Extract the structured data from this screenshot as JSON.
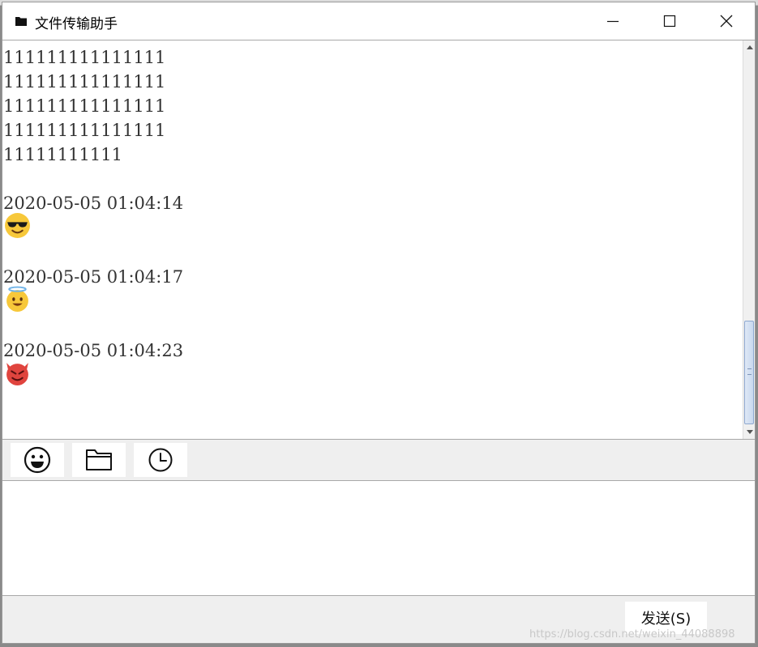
{
  "window": {
    "title": "文件传输助手",
    "icon": "folder-icon",
    "controls": [
      "minimize-icon",
      "maximize-icon",
      "close-icon"
    ]
  },
  "chat": {
    "lines": [
      "111111111111111",
      "111111111111111",
      "111111111111111",
      "111111111111111",
      "11111111111"
    ],
    "messages": [
      {
        "timestamp": "2020-05-05 01:04:14",
        "emoji": "sunglasses-face-emoji"
      },
      {
        "timestamp": "2020-05-05 01:04:17",
        "emoji": "halo-face-emoji"
      },
      {
        "timestamp": "2020-05-05 01:04:23",
        "emoji": "devil-face-emoji"
      }
    ]
  },
  "toolbar": {
    "buttons": [
      "smiley-icon",
      "folder-icon",
      "clock-icon"
    ]
  },
  "input": {
    "value": ""
  },
  "footer": {
    "send_label": "发送(S)",
    "watermark": "https://blog.csdn.net/weixin_44088898"
  },
  "colors": {
    "window_bg": "#efefef",
    "scroll_thumb": "#c8d8ee",
    "emoji_yellow": "#f7c83a",
    "emoji_red": "#e0443e"
  }
}
